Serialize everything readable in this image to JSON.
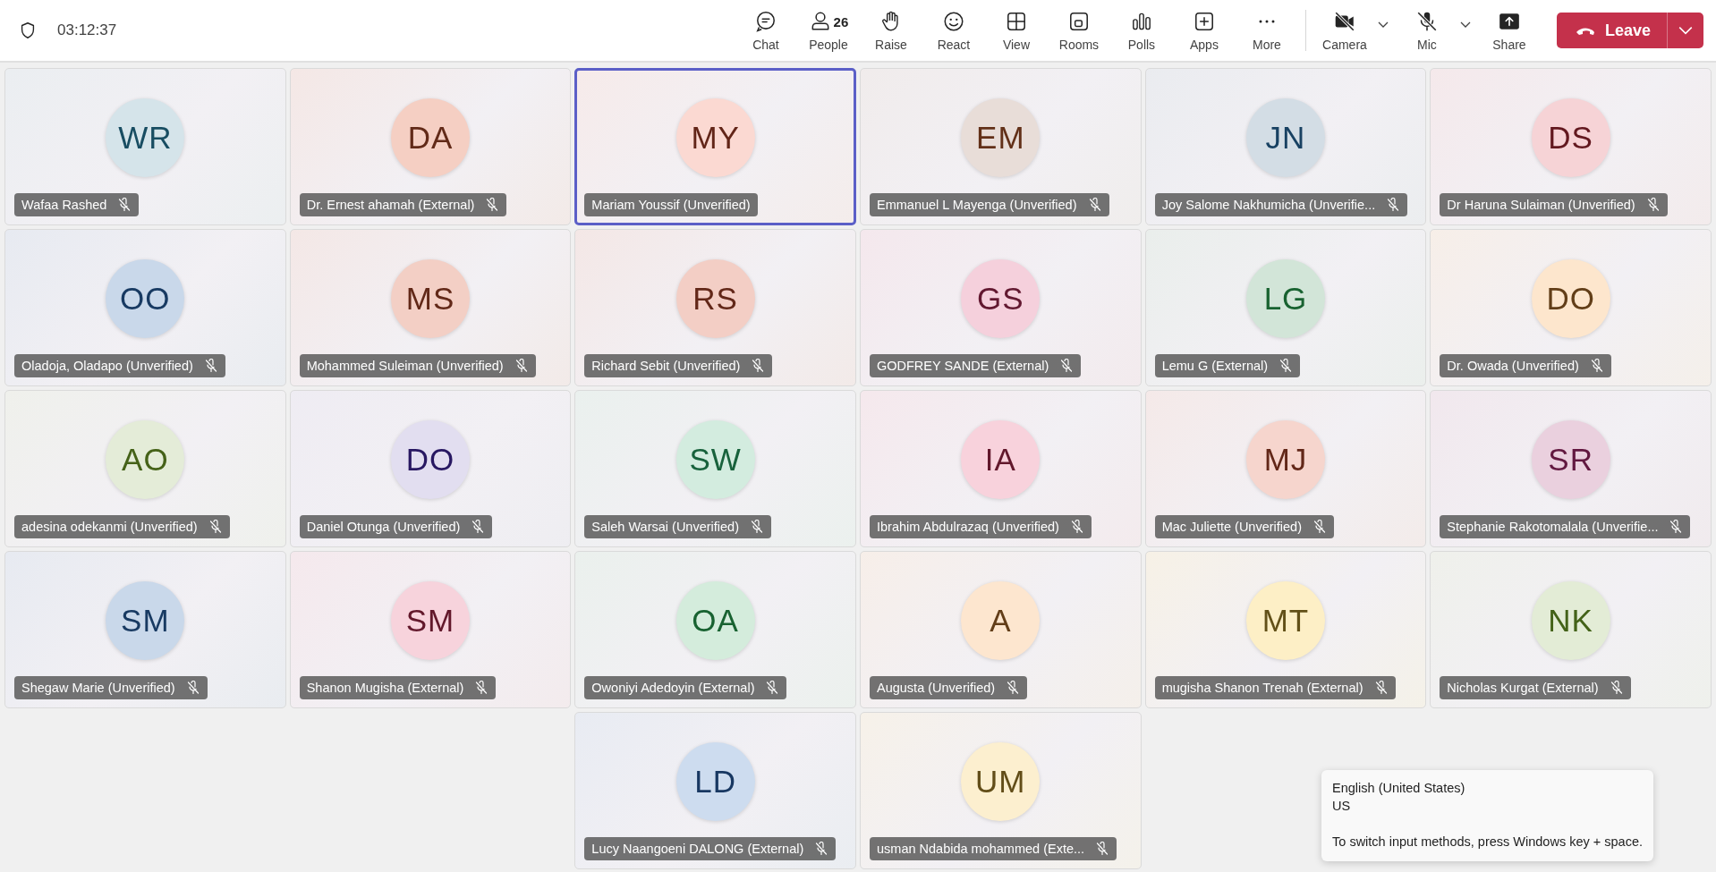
{
  "header": {
    "timer": "03:12:37"
  },
  "toolbar": [
    {
      "kind": "chat",
      "label": "Chat"
    },
    {
      "kind": "people",
      "label": "People",
      "count": "26"
    },
    {
      "kind": "raise",
      "label": "Raise"
    },
    {
      "kind": "react",
      "label": "React"
    },
    {
      "kind": "view",
      "label": "View"
    },
    {
      "kind": "rooms",
      "label": "Rooms"
    },
    {
      "kind": "polls",
      "label": "Polls"
    },
    {
      "kind": "apps",
      "label": "Apps"
    },
    {
      "kind": "more",
      "label": "More"
    }
  ],
  "devices": [
    {
      "kind": "camera",
      "label": "Camera",
      "off": true
    },
    {
      "kind": "mic",
      "label": "Mic",
      "off": true
    },
    {
      "kind": "share",
      "label": "Share"
    }
  ],
  "leave": {
    "label": "Leave"
  },
  "participants": [
    {
      "initials": "WR",
      "name": "Wafaa Rashed",
      "muted": true,
      "speaking": false,
      "color": "#d5e4ea"
    },
    {
      "initials": "DA",
      "name": "Dr. Ernest ahamah (External)",
      "muted": true,
      "speaking": false,
      "color": "#f5cfc3"
    },
    {
      "initials": "MY",
      "name": "Mariam Youssif (Unverified)",
      "muted": false,
      "speaking": true,
      "color": "#fbd9d2"
    },
    {
      "initials": "EM",
      "name": "Emmanuel L Mayenga (Unverified)",
      "muted": true,
      "speaking": false,
      "color": "#e8ddd8"
    },
    {
      "initials": "JN",
      "name": "Joy Salome Nakhumicha (Unverifie...",
      "muted": true,
      "speaking": false,
      "color": "#d3dde5"
    },
    {
      "initials": "DS",
      "name": "Dr Haruna Sulaiman (Unverified)",
      "muted": true,
      "speaking": false,
      "color": "#f6d3d6"
    },
    {
      "initials": "OO",
      "name": "Oladoja, Oladapo (Unverified)",
      "muted": true,
      "speaking": false,
      "color": "#c9d8ea"
    },
    {
      "initials": "MS",
      "name": "Mohammed Suleiman (Unverified)",
      "muted": true,
      "speaking": false,
      "color": "#f3cfc5"
    },
    {
      "initials": "RS",
      "name": "Richard Sebit (Unverified)",
      "muted": true,
      "speaking": false,
      "color": "#f3cec5"
    },
    {
      "initials": "GS",
      "name": "GODFREY SANDE (External)",
      "muted": true,
      "speaking": false,
      "color": "#f5d0dc"
    },
    {
      "initials": "LG",
      "name": "Lemu G (External)",
      "muted": true,
      "speaking": false,
      "color": "#d2e5d8"
    },
    {
      "initials": "DO",
      "name": "Dr. Owada (Unverified)",
      "muted": true,
      "speaking": false,
      "color": "#fde6cd"
    },
    {
      "initials": "AO",
      "name": "adesina odekanmi (Unverified)",
      "muted": true,
      "speaking": false,
      "color": "#e4ecd8"
    },
    {
      "initials": "DO",
      "name": "Daniel Otunga (Unverified)",
      "muted": true,
      "speaking": false,
      "color": "#e2def0"
    },
    {
      "initials": "SW",
      "name": "Saleh Warsai (Unverified)",
      "muted": true,
      "speaking": false,
      "color": "#d3ecdf"
    },
    {
      "initials": "IA",
      "name": "Ibrahim Abdulrazaq (Unverified)",
      "muted": true,
      "speaking": false,
      "color": "#f8d2dc"
    },
    {
      "initials": "MJ",
      "name": "Mac Juliette (Unverified)",
      "muted": true,
      "speaking": false,
      "color": "#f6d5cd"
    },
    {
      "initials": "SR",
      "name": "Stephanie Rakotomalala (Unverifie...",
      "muted": true,
      "speaking": false,
      "color": "#ead0de"
    },
    {
      "initials": "SM",
      "name": "Shegaw Marie (Unverified)",
      "muted": true,
      "speaking": false,
      "color": "#c9d8ea"
    },
    {
      "initials": "SM",
      "name": "Shanon Mugisha (External)",
      "muted": true,
      "speaking": false,
      "color": "#f7d3dc"
    },
    {
      "initials": "OA",
      "name": "Owoniyi Adedoyin (External)",
      "muted": true,
      "speaking": false,
      "color": "#d4ecdc"
    },
    {
      "initials": "A",
      "name": "Augusta (Unverified)",
      "muted": true,
      "speaking": false,
      "color": "#fde6cf"
    },
    {
      "initials": "MT",
      "name": "mugisha Shanon Trenah (External)",
      "muted": true,
      "speaking": false,
      "color": "#fdefc6"
    },
    {
      "initials": "NK",
      "name": "Nicholas Kurgat (External)",
      "muted": true,
      "speaking": false,
      "color": "#e3ecd6"
    },
    {
      "initials": "LD",
      "name": "Lucy Naangoeni DALONG (External)",
      "muted": true,
      "speaking": false,
      "color": "#cddcef"
    },
    {
      "initials": "UM",
      "name": "usman Ndabida mohammed (Exte...",
      "muted": true,
      "speaking": false,
      "color": "#fcefcf"
    }
  ],
  "tooltip": {
    "lines": [
      "English (United States)",
      "US",
      "To switch input methods, press Windows key + space."
    ]
  }
}
